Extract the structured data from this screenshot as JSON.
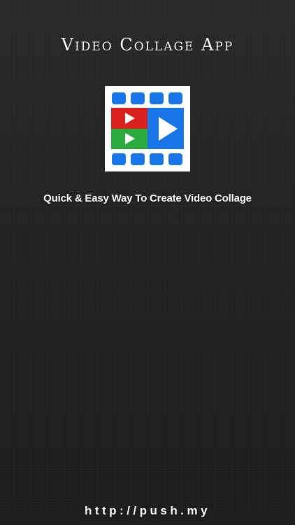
{
  "app": {
    "title": "Video Collage App",
    "tagline": "Quick & Easy Way To Create Video Collage",
    "url": "http://push.my"
  },
  "logo": {
    "icon": "video-collage-icon",
    "colors": {
      "background": "#ffffff",
      "blue": "#1976e8",
      "red": "#d9201d",
      "green": "#2bab3d",
      "play": "#ffffff"
    }
  },
  "theme": {
    "background": "#222222",
    "text": "#ffffff"
  }
}
